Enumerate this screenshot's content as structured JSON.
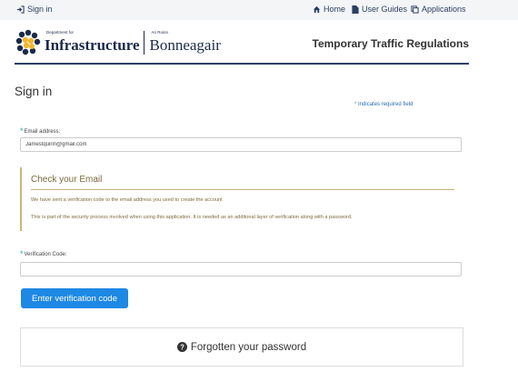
{
  "topbar": {
    "sign_in": "Sign in",
    "home": "Home",
    "user_guides": "User Guides",
    "applications": "Applications"
  },
  "header": {
    "org_small": "Department for",
    "org_name": "Infrastructure",
    "org_small_irish": "An Roinn",
    "org_name_irish": "Bonneagair",
    "app_title": "Temporary Traffic Regulations"
  },
  "page": {
    "title": "Sign in",
    "required_note": "Indicates required field",
    "required_marker": "*"
  },
  "email": {
    "label": "Email address:",
    "value": "Jamestquinn@gmail.com"
  },
  "alert": {
    "title": "Check your Email",
    "line1": "We have sent a verification code to the email address you used to create the account",
    "line2": "This is part of the security process involved when using this application. It is needed as an additonal layer of verification along with a password."
  },
  "verification": {
    "label": "Verification Code:",
    "value": "",
    "button": "Enter verification code"
  },
  "forgot": {
    "label": "Forgotten your password"
  },
  "colors": {
    "navy": "#2b3f63",
    "button_blue": "#1e88e5",
    "alert_border": "#c8b57a",
    "required": "#2aa7a7"
  },
  "icons": [
    "sign-in-icon",
    "home-icon",
    "file-icon",
    "applications-icon",
    "question-circle-icon"
  ]
}
